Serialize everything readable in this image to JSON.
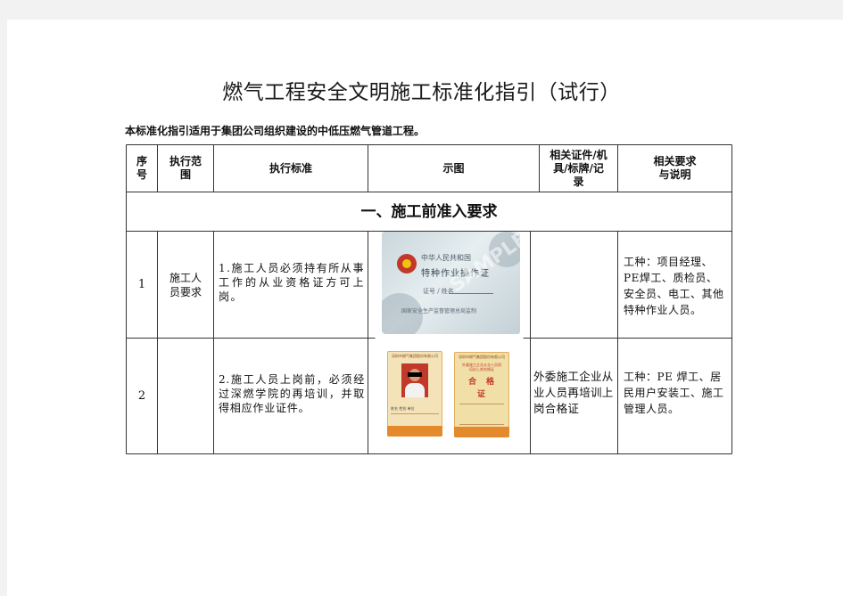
{
  "title": "燃气工程安全文明施工标准化指引（试行）",
  "intro": "本标准化指引适用于集团公司组织建设的中低压燃气管道工程。",
  "table": {
    "headers": {
      "seq": [
        "序",
        "号"
      ],
      "scope": [
        "执行范",
        "围"
      ],
      "standard": "执行标准",
      "figure": "示图",
      "certs": [
        "相关证件/机",
        "具/标牌/记",
        "录"
      ],
      "notes": [
        "相关要求",
        "与说明"
      ]
    },
    "section": "一、施工前准入要求",
    "rows": [
      {
        "seq": "1",
        "scope": [
          "施工人",
          "员要求"
        ],
        "standard": "1.施工人员必须持有所从事工作的从业资格证方可上岗。",
        "certs": "",
        "notes": "工种：项目经理、PE焊工、质检员、安全员、电工、其他特种作业人员。"
      },
      {
        "seq": "2",
        "scope": [],
        "standard": "2.施工人员上岗前，必须经过深燃学院的再培训，并取得相应作业证件。",
        "certs": "外委施工企业从业人员再培训上岗合格证",
        "notes": "工种：PE 焊工、居民用户安装工、施工管理人员。"
      }
    ]
  },
  "card1": {
    "line1": "中华人民共和国",
    "line2": "特种作业操作证",
    "line3": "证号 / 姓名",
    "footer": "国家安全生产监督管理总局监制",
    "watermark": "SAMPLE"
  },
  "card2": {
    "header": "深圳市燃气集团股份有限公司",
    "fields": "姓名  性别  单位"
  },
  "card3": {
    "header": "深圳市燃气集团股份有限公司",
    "sub": "外委施工企业从业人员再培训上岗合格证",
    "big1": "合",
    "big2": "格",
    "big3": "证"
  },
  "colors": {
    "line": "#333333",
    "card_bg": "#d9e3e6",
    "badge_red": "#c0392b",
    "orange": "#e58a2c"
  }
}
